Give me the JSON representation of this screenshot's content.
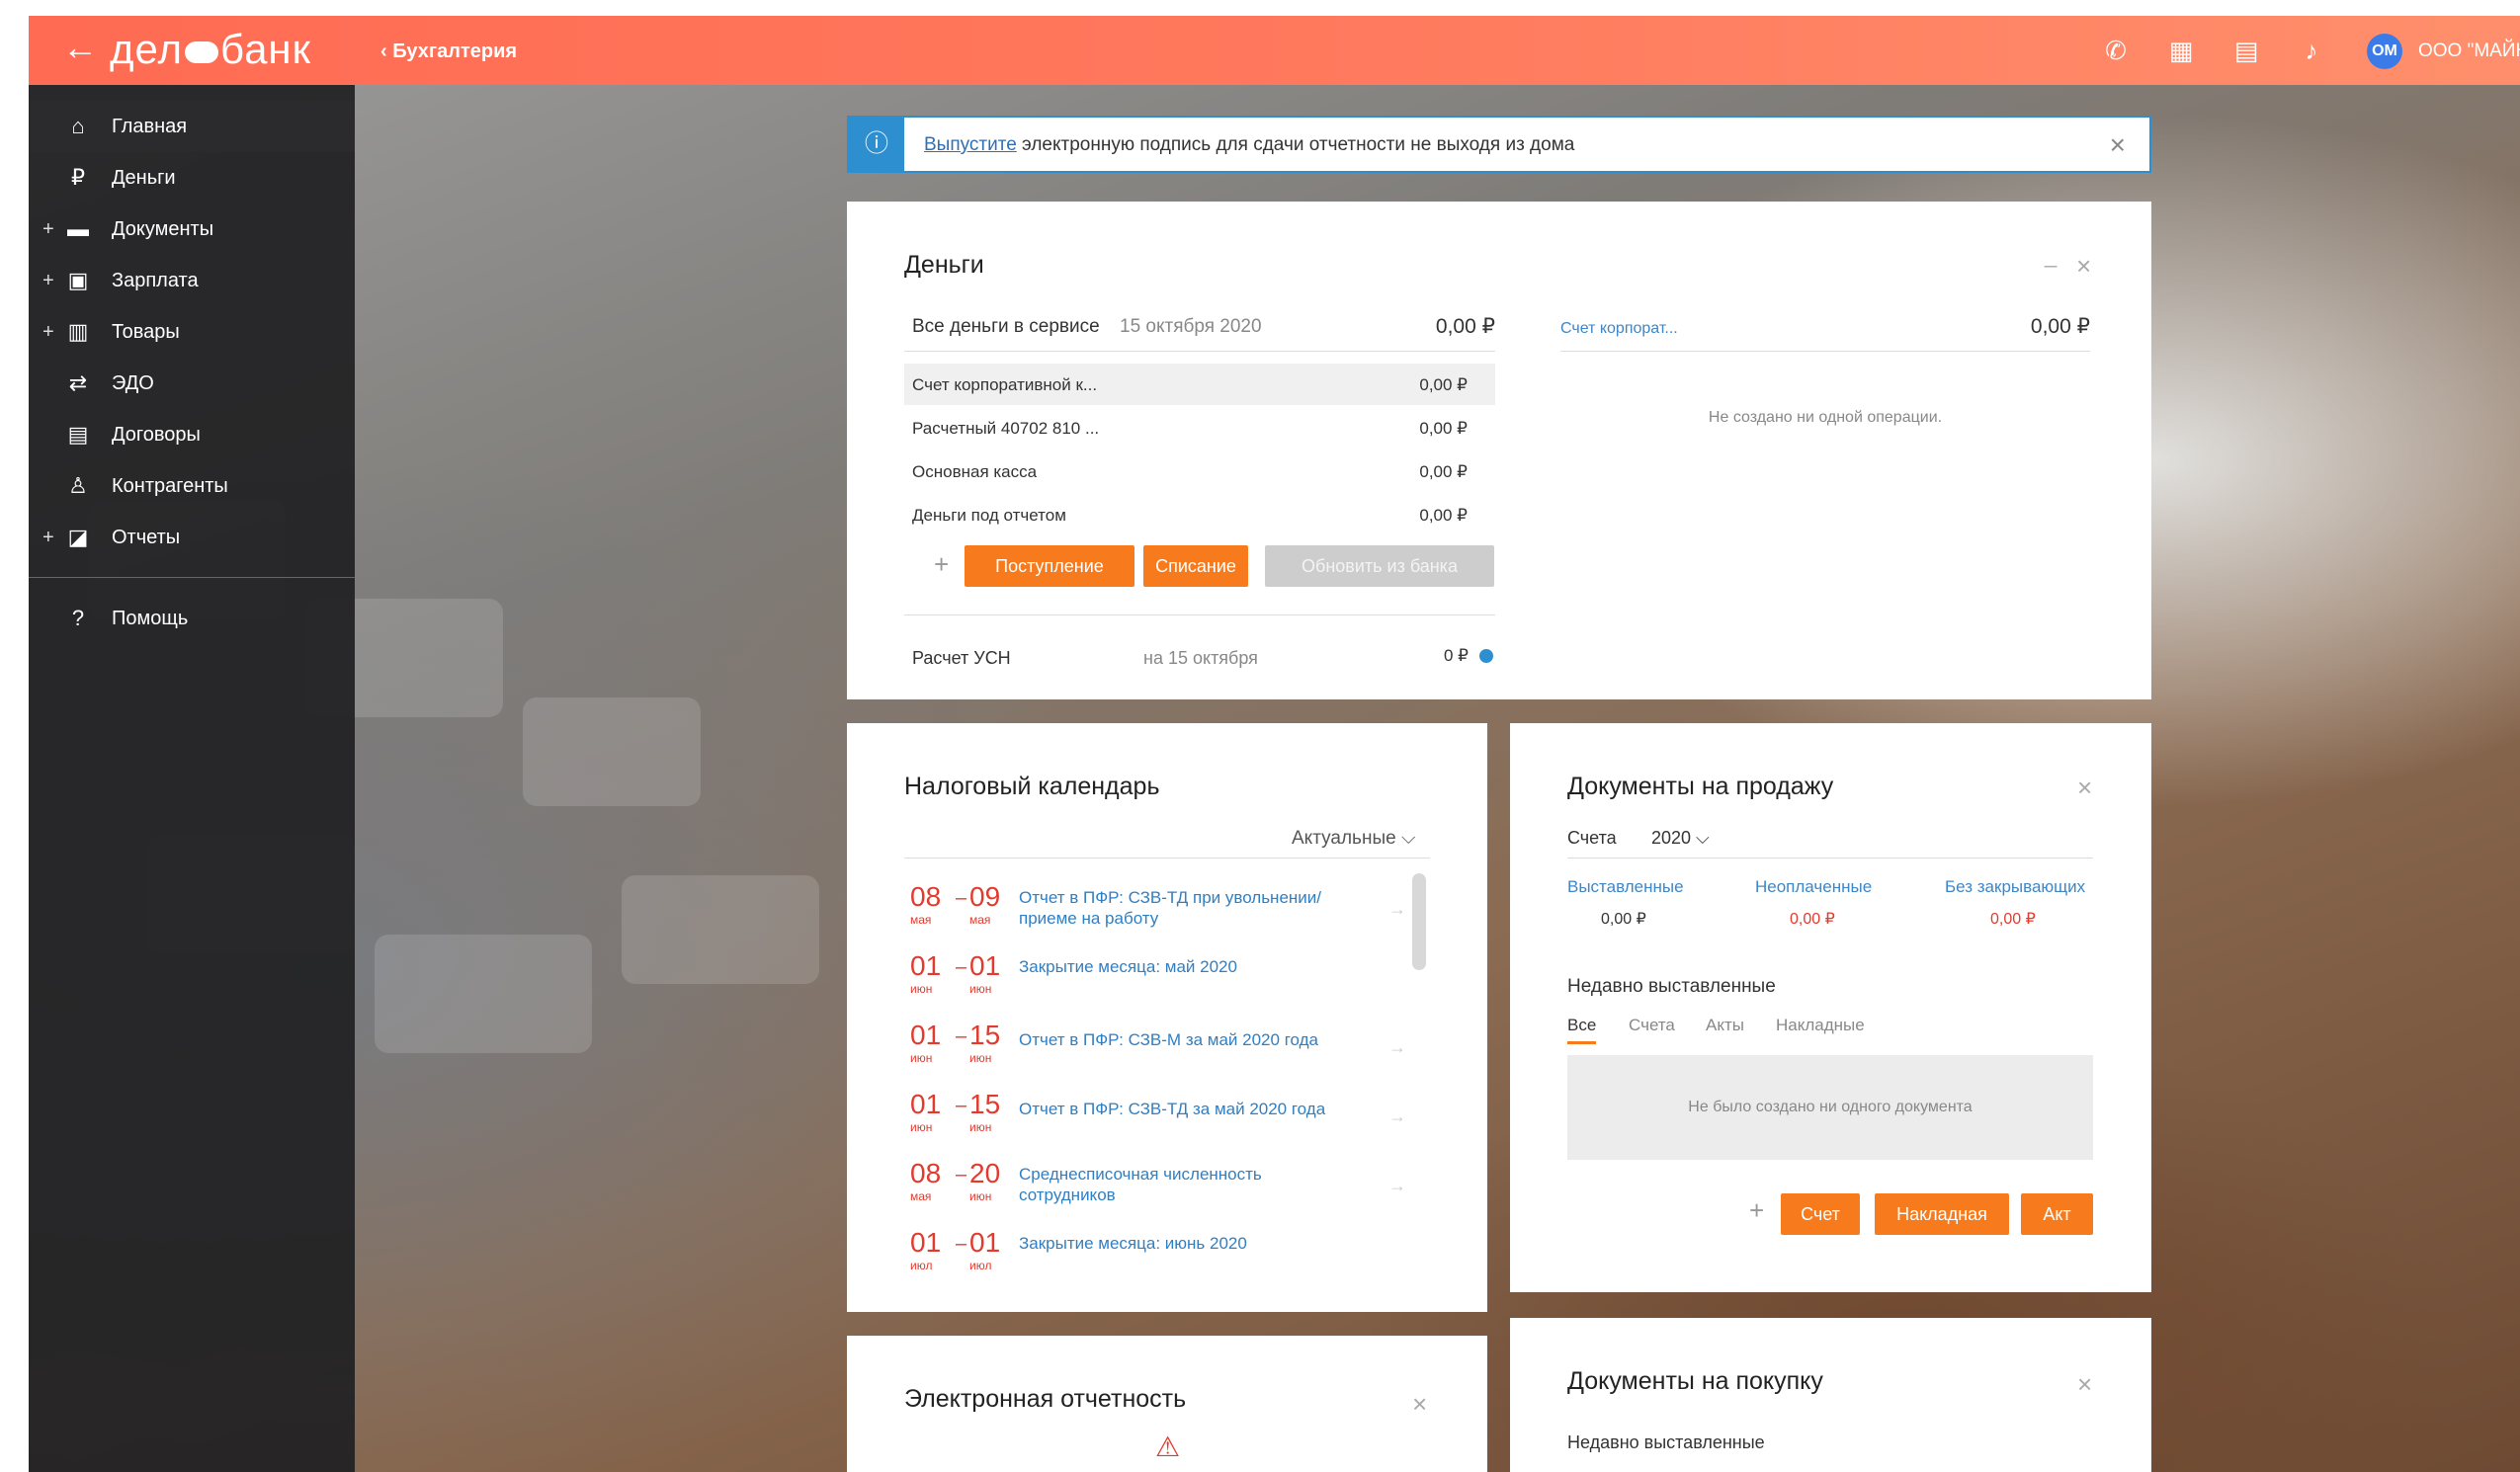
{
  "header": {
    "back_glyph": "←",
    "logo_left": "дел",
    "logo_right": "банк",
    "breadcrumb": "‹ Бухгалтерия",
    "icons": [
      "phone-icon",
      "calculator-icon",
      "chat-icon",
      "bell-icon",
      "gear-icon"
    ],
    "avatar_initials": "ОМ",
    "org_name": "ООО \"МАЙКО"
  },
  "sidebar": {
    "items": [
      {
        "label": "Главная",
        "icon": "home-icon",
        "plus": ""
      },
      {
        "label": "Деньги",
        "icon": "money-icon",
        "plus": ""
      },
      {
        "label": "Документы",
        "icon": "folder-icon",
        "plus": "+"
      },
      {
        "label": "Зарплата",
        "icon": "salary-icon",
        "plus": "+"
      },
      {
        "label": "Товары",
        "icon": "goods-icon",
        "plus": "+"
      },
      {
        "label": "ЭДО",
        "icon": "edo-icon",
        "plus": ""
      },
      {
        "label": "Договоры",
        "icon": "contract-icon",
        "plus": ""
      },
      {
        "label": "Контрагенты",
        "icon": "contractors-icon",
        "plus": ""
      },
      {
        "label": "Отчеты",
        "icon": "reports-icon",
        "plus": "+"
      }
    ],
    "help": {
      "label": "Помощь",
      "icon": "help-icon"
    }
  },
  "notice": {
    "link": "Выпустите",
    "text": " электронную подпись для сдачи отчетности не выходя из дома",
    "close": "×"
  },
  "money": {
    "title": "Деньги",
    "minimize": "_",
    "close": "×",
    "total_label": "Все деньги в сервисе",
    "total_date": "15 октября 2020",
    "total_value": "0,00 ₽",
    "rows": [
      {
        "name": "Счет корпоративной к...",
        "value": "0,00 ₽"
      },
      {
        "name": "Расчетный 40702 810 ...",
        "value": "0,00 ₽"
      },
      {
        "name": "Основная касса",
        "value": "0,00 ₽"
      },
      {
        "name": "Деньги под отчетом",
        "value": "0,00 ₽"
      }
    ],
    "plus": "+",
    "btn_income": "Поступление",
    "btn_expense": "Списание",
    "btn_update": "Обновить из банка",
    "usn_label": "Расчет УСН",
    "usn_date": "на 15 октября",
    "usn_value": "0 ₽",
    "right_account": "Счет корпорат...",
    "right_value": "0,00 ₽",
    "right_empty": "Не создано ни одной операции."
  },
  "tax": {
    "title": "Налоговый календарь",
    "filter": "Актуальные ⌵",
    "rows": [
      {
        "d1": "08",
        "m1": "мая",
        "d2": "09",
        "m2": "мая",
        "text": "Отчет в ПФР: СЗВ-ТД при увольнении/ приеме на работу"
      },
      {
        "d1": "01",
        "m1": "июн",
        "d2": "01",
        "m2": "июн",
        "text": "Закрытие месяца: май 2020"
      },
      {
        "d1": "01",
        "m1": "июн",
        "d2": "15",
        "m2": "июн",
        "text": "Отчет в ПФР: СЗВ-М за май 2020 года"
      },
      {
        "d1": "01",
        "m1": "июн",
        "d2": "15",
        "m2": "июн",
        "text": "Отчет в ПФР: СЗВ-ТД за май 2020 года"
      },
      {
        "d1": "08",
        "m1": "мая",
        "d2": "20",
        "m2": "июн",
        "text": "Среднесписочная численность сотрудников"
      },
      {
        "d1": "01",
        "m1": "июл",
        "d2": "01",
        "m2": "июл",
        "text": "Закрытие месяца: июнь 2020"
      }
    ]
  },
  "sales": {
    "title": "Документы на продажу",
    "close": "×",
    "doc_type": "Счета",
    "year": "2020 ⌵",
    "stats": [
      {
        "label": "Выставленные",
        "value": "0,00 ₽"
      },
      {
        "label": "Неоплаченные",
        "value": "0,00 ₽"
      },
      {
        "label": "Без закрывающих",
        "value": "0,00 ₽"
      }
    ],
    "recent_title": "Недавно выставленные",
    "tabs": [
      "Все",
      "Счета",
      "Акты",
      "Накладные"
    ],
    "empty": "Не было создано ни одного документа",
    "plus": "+",
    "btn_invoice": "Счет",
    "btn_waybill": "Накладная",
    "btn_act": "Акт"
  },
  "ereport": {
    "title": "Электронная отчетность",
    "close": "×",
    "warn": "⚠"
  },
  "purchase": {
    "title": "Документы на покупку",
    "close": "×",
    "recent_title": "Недавно выставленные"
  }
}
